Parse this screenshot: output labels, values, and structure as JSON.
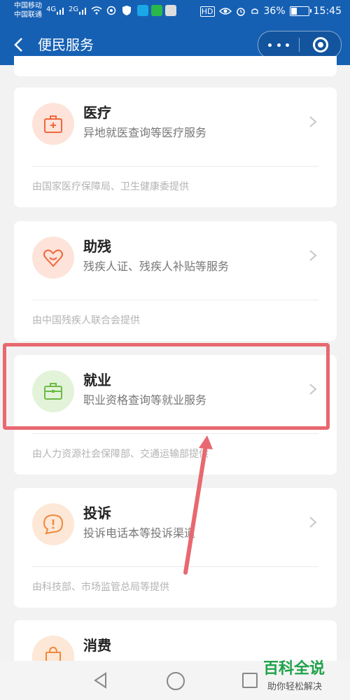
{
  "status_bar": {
    "carrier1": "中国移动",
    "carrier2": "中国联通",
    "signal1": "4G",
    "signal2": "2G",
    "hd": "HD",
    "battery": "36%",
    "battery_level": 0.36,
    "time": "15:45"
  },
  "nav": {
    "title": "便民服务",
    "back_icon": "chevron-left-icon",
    "more_icon": "more-dots-icon",
    "close_icon": "target-circle-icon"
  },
  "cards": [
    {
      "title": "医疗",
      "desc": "异地就医查询等医疗服务",
      "source": "由国家医疗保障局、卫生健康委提供",
      "icon": "medical-kit-icon",
      "color": "#f0673d",
      "bg": "#fde3d9"
    },
    {
      "title": "助残",
      "desc": "残疾人证、残疾人补贴等服务",
      "source": "由中国残疾人联合会提供",
      "icon": "heart-smile-icon",
      "color": "#f0673d",
      "bg": "#fde3d9"
    },
    {
      "title": "就业",
      "desc": "职业资格查询等就业服务",
      "source": "由人力资源社会保障部、交通运输部提供",
      "icon": "briefcase-icon",
      "color": "#6dbb45",
      "bg": "#e3f3da"
    },
    {
      "title": "投诉",
      "desc": "投诉电话本等投诉渠道",
      "source": "由科技部、市场监管总局等提供",
      "icon": "exclamation-bubble-icon",
      "color": "#f0883d",
      "bg": "#fde7d6"
    },
    {
      "title": "消费",
      "desc": "",
      "source": "",
      "icon": "shopping-bag-icon",
      "color": "#f0883d",
      "bg": "#fde7d6"
    }
  ],
  "watermark": {
    "title": "百科全说",
    "subtitle": "助你轻松解决"
  },
  "colors": {
    "primary": "#1660b4",
    "highlight": "#e8686f",
    "watermark": "#1fa24a"
  }
}
